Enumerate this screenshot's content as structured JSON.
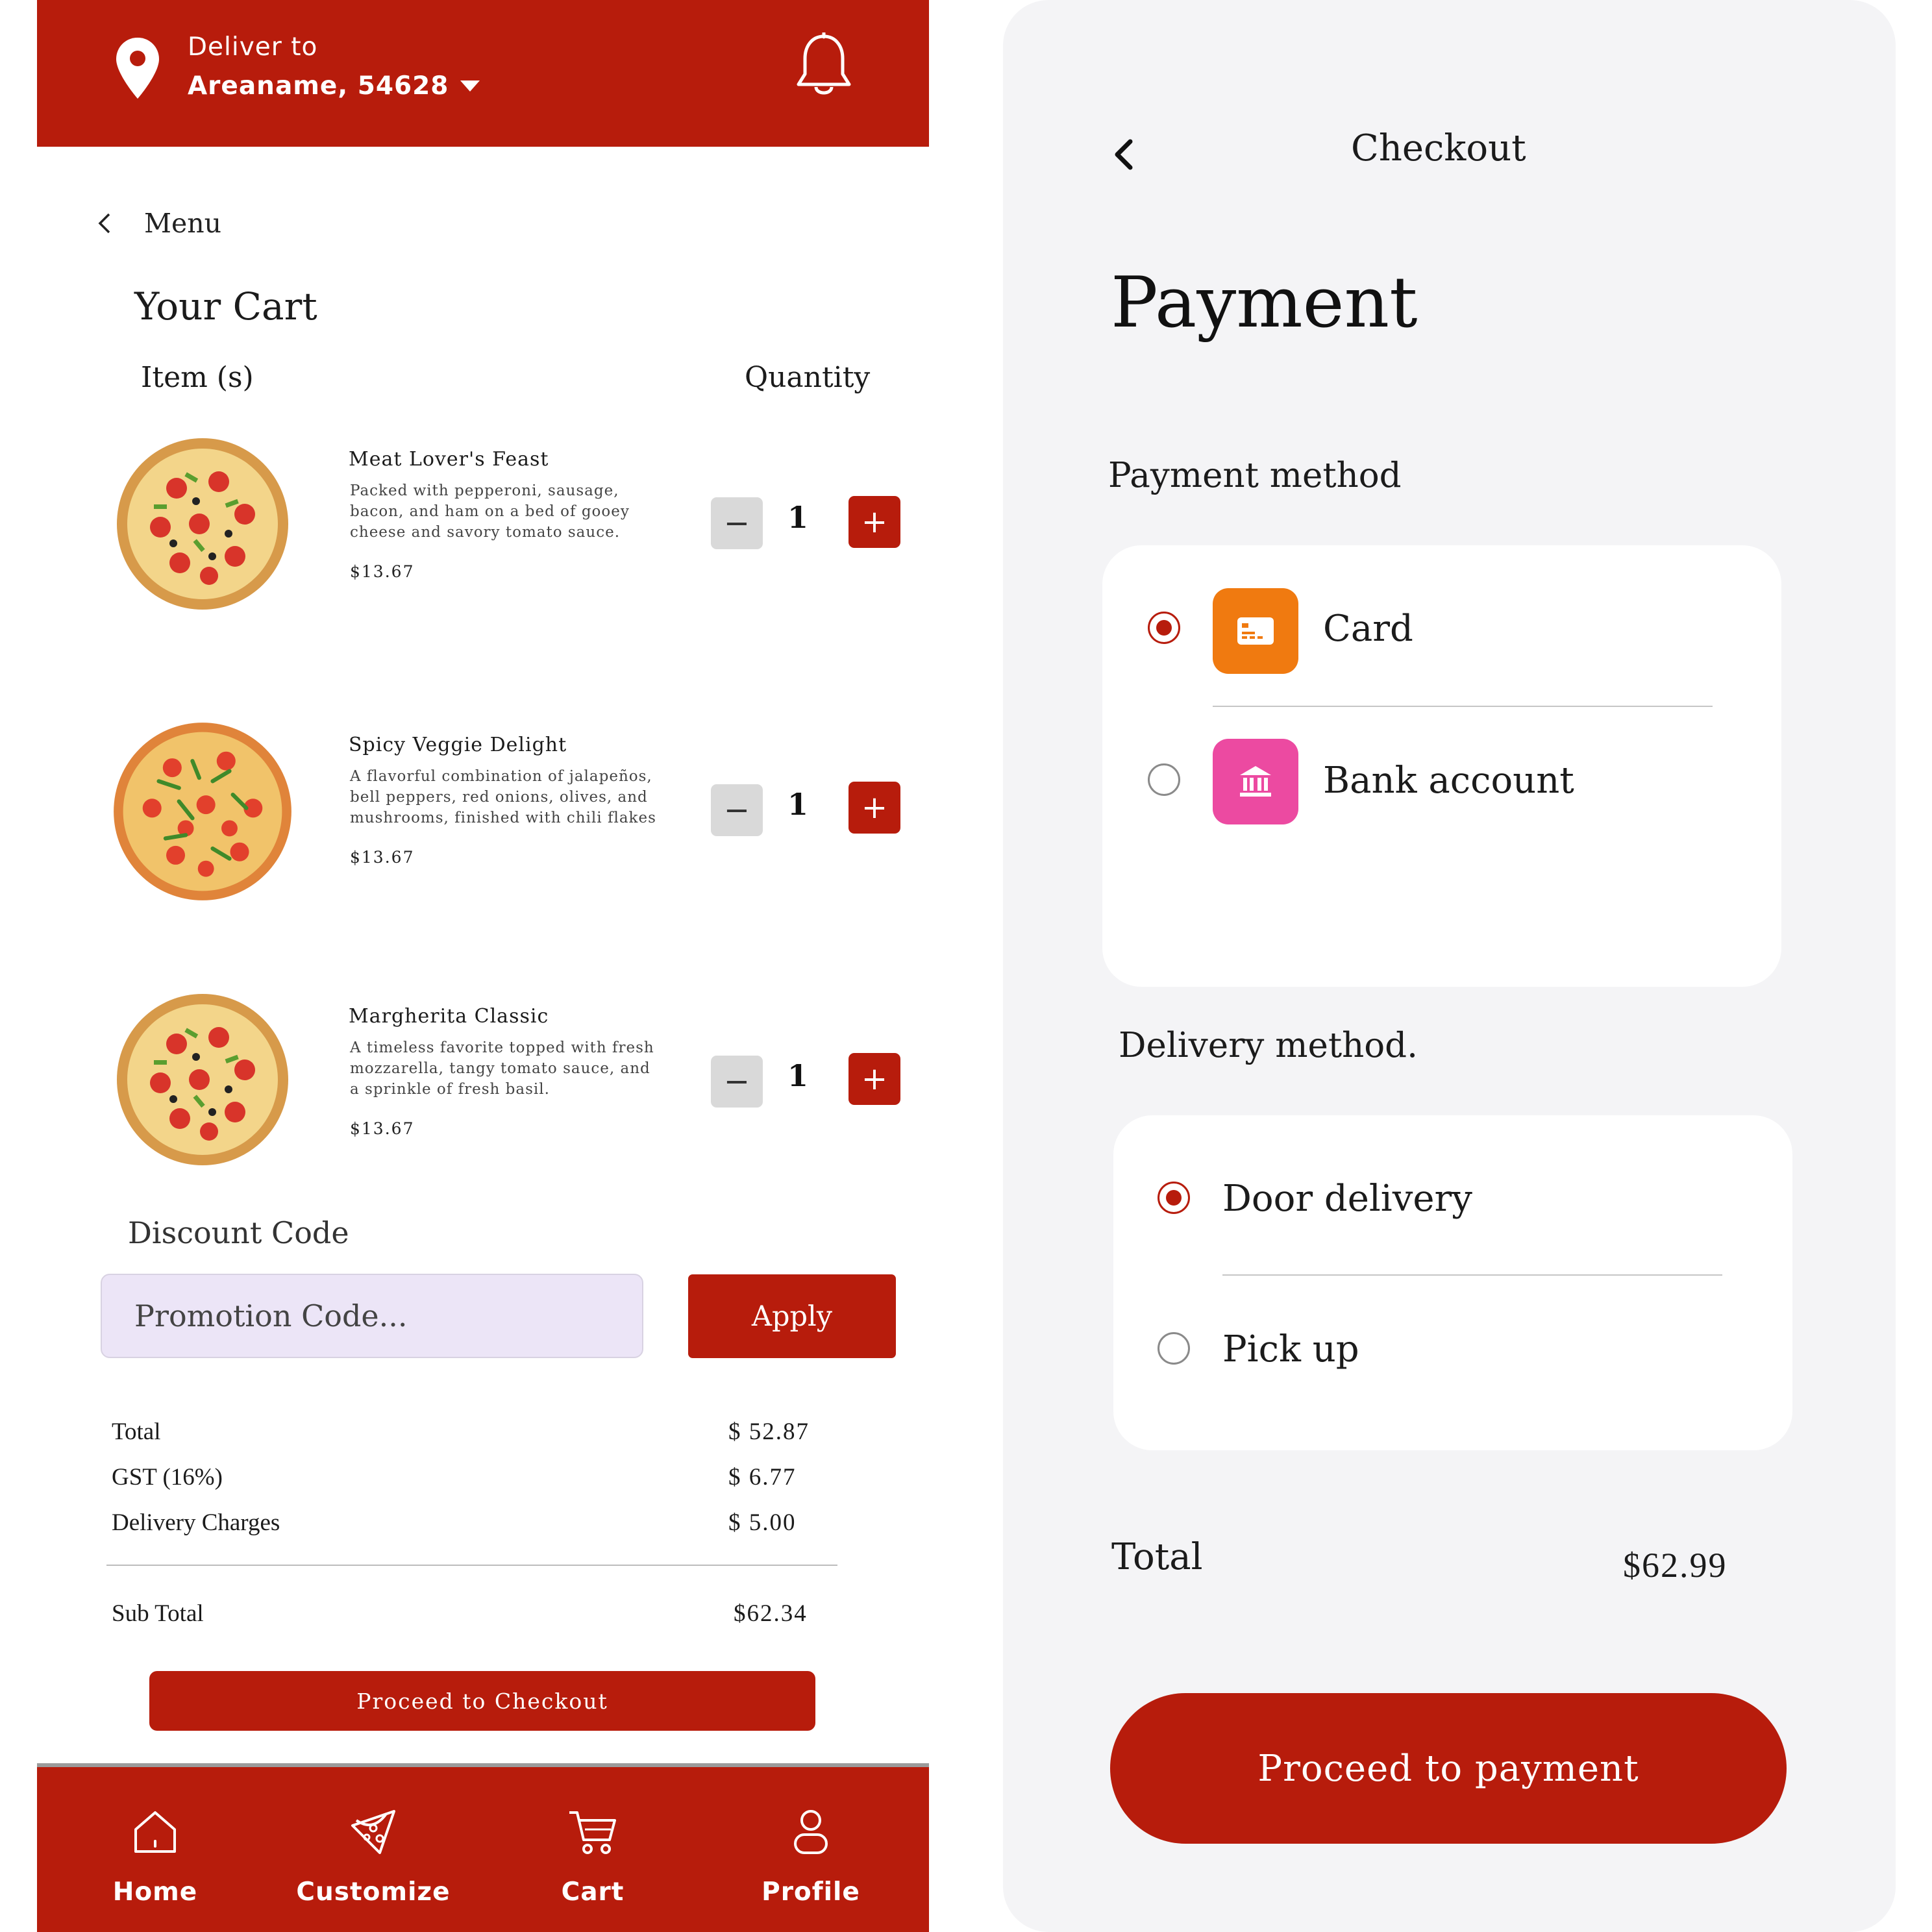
{
  "cart_screen": {
    "header": {
      "deliver_label": "Deliver to",
      "area": "Areaname, 54628",
      "location_icon": "map-pin-icon",
      "notification_icon": "bell-icon"
    },
    "back_label": "Menu",
    "title": "Your Cart",
    "column_item": "Item (s)",
    "column_quantity": "Quantity",
    "items": [
      {
        "name": "Meat Lover's Feast",
        "desc1": "Packed with pepperoni, sausage,",
        "desc2": "bacon, and ham on a bed of gooey",
        "desc3": "cheese and savory tomato sauce.",
        "price": "$13.67",
        "qty": "1"
      },
      {
        "name": "Spicy Veggie Delight",
        "desc1": "A flavorful combination of jalapeños,",
        "desc2": "bell peppers, red onions, olives, and",
        "desc3": "mushrooms, finished with chili flakes",
        "price": "$13.67",
        "qty": "1"
      },
      {
        "name": "Margherita Classic",
        "desc1": "A timeless favorite topped with fresh",
        "desc2": "mozzarella, tangy tomato sauce, and",
        "desc3": "a sprinkle of fresh basil.",
        "price": "$13.67",
        "qty": "1"
      }
    ],
    "minus_symbol": "−",
    "plus_symbol": "+",
    "discount_title": "Discount Code",
    "promo_placeholder": "Promotion Code...",
    "apply_label": "Apply",
    "summary": {
      "total_label": "Total",
      "total_value": "$ 52.87",
      "gst_label": "GST (16%)",
      "gst_value": "$ 6.77",
      "delivery_label": "Delivery Charges",
      "delivery_value": "$ 5.00",
      "subtotal_label": "Sub Total",
      "subtotal_value": "$62.34"
    },
    "checkout_label": "Proceed to Checkout",
    "nav": [
      {
        "label": "Home",
        "icon": "home-icon"
      },
      {
        "label": "Customize",
        "icon": "pizza-slice-icon"
      },
      {
        "label": "Cart",
        "icon": "cart-icon"
      },
      {
        "label": "Profile",
        "icon": "user-icon"
      }
    ],
    "brand_color": "#b71c0c"
  },
  "checkout_screen": {
    "title": "Checkout",
    "heading": "Payment",
    "payment_method_title": "Payment method",
    "payment_options": [
      {
        "label": "Card",
        "selected": true,
        "icon": "credit-card-icon",
        "color": "#f07a10"
      },
      {
        "label": "Bank account",
        "selected": false,
        "icon": "bank-icon",
        "color": "#ec4aa1"
      }
    ],
    "delivery_method_title": "Delivery method.",
    "delivery_options": [
      {
        "label": "Door delivery",
        "selected": true
      },
      {
        "label": "Pick up",
        "selected": false
      }
    ],
    "total_label": "Total",
    "total_value": "$62.99",
    "pay_label": "Proceed to payment"
  }
}
